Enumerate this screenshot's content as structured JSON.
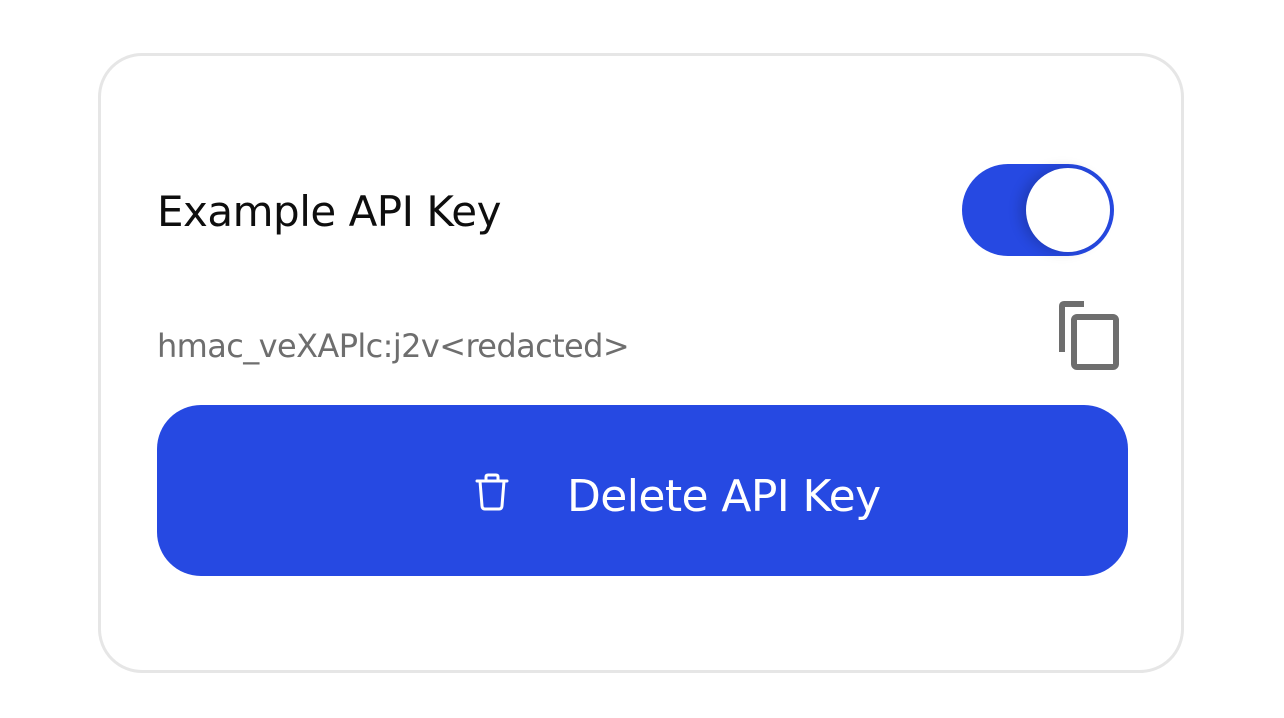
{
  "api_key_card": {
    "title": "Example API Key",
    "enabled": true,
    "key_value": "hmac_veXAPlc:j2v<redacted>",
    "copy_icon": "copy-icon",
    "delete_button": {
      "label": "Delete API Key",
      "icon": "trash-icon"
    }
  },
  "colors": {
    "accent": "#2649e2",
    "card_border": "#e6e6e6",
    "title_text": "#0e0e0e",
    "key_text": "#6e6e6e",
    "icon_gray": "#6e6e6e"
  }
}
